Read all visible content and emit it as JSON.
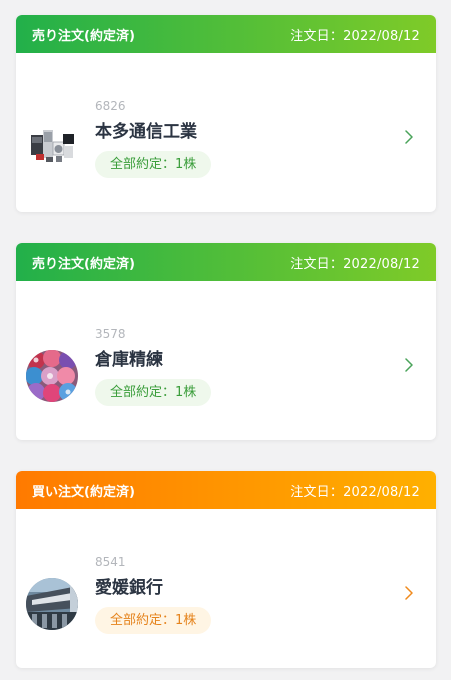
{
  "orders": [
    {
      "type_label": "売り注文(約定済)",
      "date_label": "注文日：2022/08/12",
      "code": "6826",
      "name": "本多通信工業",
      "status": "全部約定：1株",
      "accent": "#22b04a",
      "image": "appliances-photo"
    },
    {
      "type_label": "売り注文(約定済)",
      "date_label": "注文日：2022/08/12",
      "code": "3578",
      "name": "倉庫精練",
      "status": "全部約定：1株",
      "accent": "#22b04a",
      "image": "yarn-spools-photo"
    },
    {
      "type_label": "買い注文(約定済)",
      "date_label": "注文日：2022/08/12",
      "code": "8541",
      "name": "愛媛銀行",
      "status": "全部約定：1株",
      "accent": "#ff8a00",
      "image": "bank-building-photo"
    }
  ],
  "icons": {
    "chevron": "chevron-right-icon"
  }
}
